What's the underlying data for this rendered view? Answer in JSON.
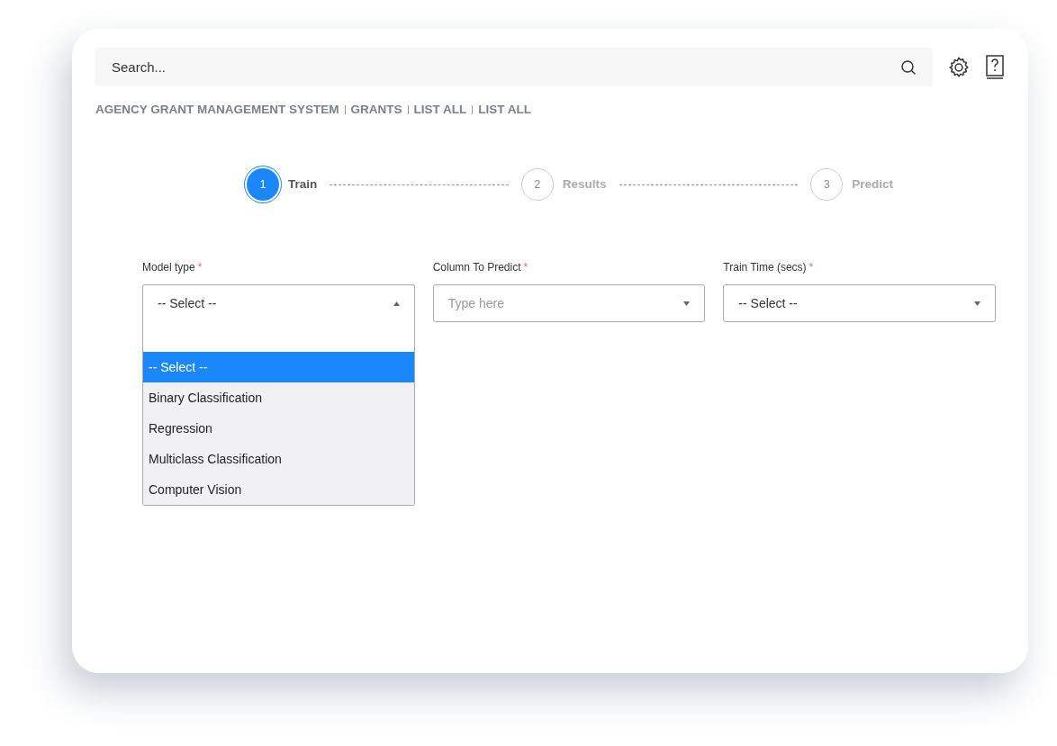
{
  "search": {
    "placeholder": "Search..."
  },
  "breadcrumb": [
    "AGENCY GRANT MANAGEMENT SYSTEM",
    "GRANTS",
    "LIST ALL",
    "LIST ALL"
  ],
  "steps": [
    {
      "number": "1",
      "label": "Train",
      "selected": true
    },
    {
      "number": "2",
      "label": "Results",
      "selected": false
    },
    {
      "number": "3",
      "label": "Predict",
      "selected": false
    }
  ],
  "fields": [
    {
      "label": "Model type",
      "required": "*",
      "value": "-- Select --",
      "expanded": true,
      "options": [
        {
          "label": "-- Select --",
          "selected": true
        },
        {
          "label": "Binary Classification",
          "selected": false
        },
        {
          "label": "Regression",
          "selected": false
        },
        {
          "label": "Multiclass Classification",
          "selected": false
        },
        {
          "label": "Computer Vision",
          "selected": false
        }
      ]
    },
    {
      "label": "Column To Predict",
      "required": "*",
      "placeholder": "Type here",
      "expanded": false
    },
    {
      "label": "Train Time (secs)",
      "required": "*",
      "value": "-- Select --",
      "expanded": false
    }
  ]
}
